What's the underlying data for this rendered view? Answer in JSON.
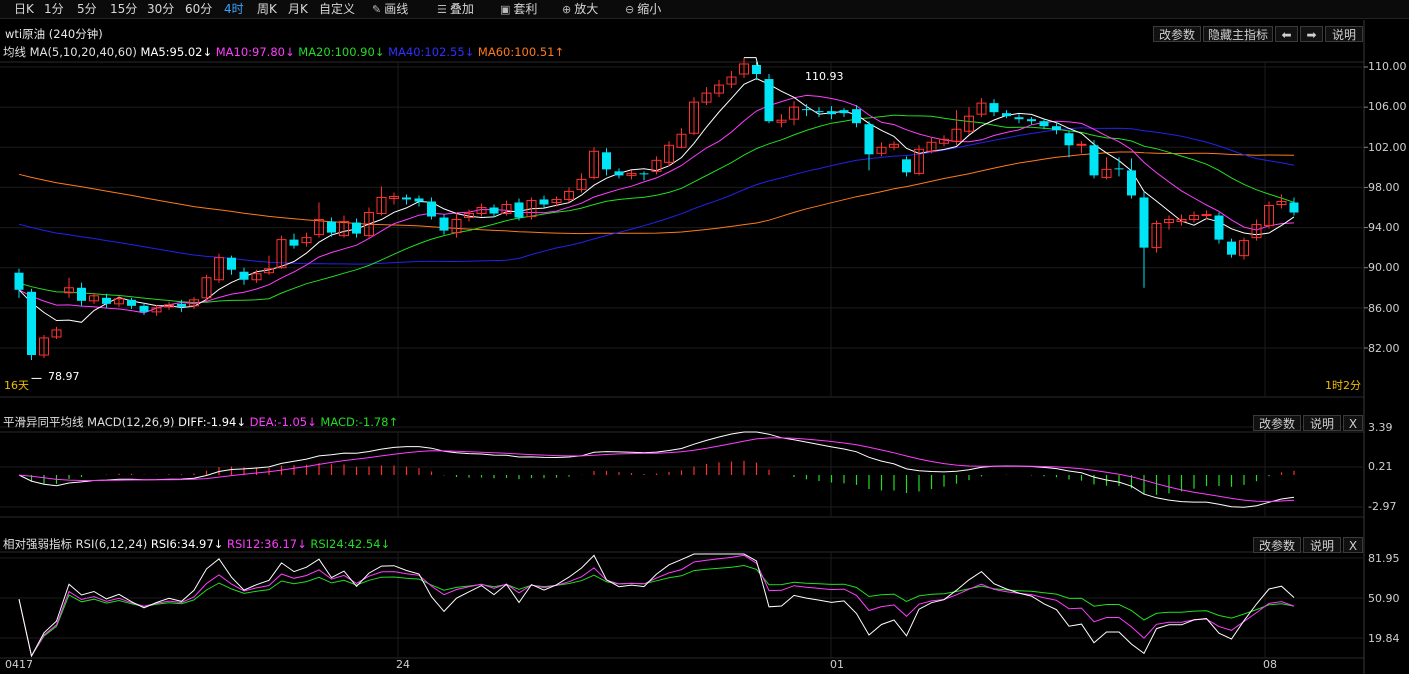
{
  "toolbar": {
    "periods": [
      "日K",
      "1分",
      "5分",
      "15分",
      "30分",
      "60分",
      "4时",
      "周K",
      "月K",
      "自定义"
    ],
    "active_period": "4时",
    "tools": [
      {
        "icon": "pencil-icon",
        "label": "画线"
      },
      {
        "icon": "layers-icon",
        "label": "叠加"
      },
      {
        "icon": "arbitrage-icon",
        "label": "套利"
      },
      {
        "icon": "zoom-in-icon",
        "label": "放大"
      },
      {
        "icon": "zoom-out-icon",
        "label": "缩小"
      }
    ]
  },
  "chart_title": "wti原油 (240分钟)",
  "main_buttons": {
    "params": "改参数",
    "hide": "隐藏主指标",
    "prev": "⬅",
    "next": "➡",
    "help": "说明"
  },
  "ma_legend": {
    "name": "均线 MA(5,10,20,40,60)",
    "ma5": "MA5:95.02↓",
    "ma10": "MA10:97.80↓",
    "ma20": "MA20:100.90↓",
    "ma40": "MA40:102.55↓",
    "ma60": "MA60:100.51↑"
  },
  "colors": {
    "ma5": "#ffffff",
    "ma10": "#ff3dff",
    "ma20": "#22dd22",
    "ma40": "#2222ee",
    "ma60": "#ff7a1a",
    "up": "#ff3030",
    "down": "#00e5f5"
  },
  "price_axis": [
    "110.00",
    "106.00",
    "102.00",
    "98.00",
    "94.00",
    "90.00",
    "86.00",
    "82.00"
  ],
  "annotations": {
    "high": "110.93",
    "low": "78.97",
    "left_span": "16天",
    "right_span": "1时2分"
  },
  "macd": {
    "legend_name": "平滑异同平均线 MACD(12,26,9)",
    "diff": "DIFF:-1.94↓",
    "dea": "DEA:-1.05↓",
    "macd": "MACD:-1.78↑",
    "axis": [
      "3.39",
      "0.21",
      "-2.97"
    ],
    "buttons": {
      "params": "改参数",
      "help": "说明",
      "close": "X"
    }
  },
  "rsi": {
    "legend_name": "相对强弱指标 RSI(6,12,24)",
    "rsi6": "RSI6:34.97↓",
    "rsi12": "RSI12:36.17↓",
    "rsi24": "RSI24:42.54↓",
    "axis": [
      "81.95",
      "50.90",
      "19.84"
    ],
    "buttons": {
      "params": "改参数",
      "help": "说明",
      "close": "X"
    }
  },
  "x_axis": [
    "0417",
    "24",
    "01",
    "08"
  ],
  "chart_data": {
    "type": "candlestick",
    "title": "wti原油 (240分钟)",
    "y_ticks": [
      110,
      106,
      102,
      98,
      94,
      90,
      86,
      82
    ],
    "high": 110.93,
    "low": 78.97,
    "candles": [
      [
        89.5,
        87.8,
        89.9,
        87.0
      ],
      [
        87.6,
        81.3,
        87.9,
        80.8
      ],
      [
        81.3,
        83.0,
        83.3,
        81.0
      ],
      [
        83.1,
        83.8,
        84.1,
        82.9
      ],
      [
        87.5,
        88.0,
        89.0,
        87.0
      ],
      [
        88.0,
        86.7,
        88.5,
        86.2
      ],
      [
        86.7,
        87.2,
        87.5,
        86.4
      ],
      [
        87.0,
        86.4,
        87.4,
        86.0
      ],
      [
        86.4,
        86.9,
        87.2,
        86.1
      ],
      [
        86.8,
        86.2,
        87.0,
        85.9
      ],
      [
        86.2,
        85.6,
        86.5,
        85.3
      ],
      [
        85.6,
        86.0,
        86.3,
        85.2
      ],
      [
        86.1,
        86.3,
        86.6,
        85.8
      ],
      [
        86.4,
        86.1,
        86.8,
        85.6
      ],
      [
        86.2,
        86.8,
        87.1,
        85.9
      ],
      [
        87.0,
        89.0,
        89.3,
        86.7
      ],
      [
        88.8,
        91.0,
        91.4,
        88.5
      ],
      [
        91.0,
        89.8,
        91.2,
        89.3
      ],
      [
        89.6,
        88.8,
        90.0,
        88.3
      ],
      [
        88.8,
        89.4,
        89.8,
        88.5
      ],
      [
        89.5,
        89.9,
        91.2,
        89.3
      ],
      [
        90.0,
        92.8,
        93.2,
        89.9
      ],
      [
        92.8,
        92.2,
        93.4,
        91.9
      ],
      [
        92.5,
        93.0,
        93.5,
        92.1
      ],
      [
        93.3,
        94.8,
        96.5,
        93.0
      ],
      [
        94.6,
        93.5,
        95.0,
        93.1
      ],
      [
        93.2,
        94.6,
        95.2,
        93.0
      ],
      [
        94.5,
        93.4,
        94.9,
        93.0
      ],
      [
        93.2,
        95.5,
        96.0,
        93.0
      ],
      [
        95.4,
        97.0,
        98.1,
        95.2
      ],
      [
        96.9,
        97.1,
        97.5,
        96.3
      ],
      [
        97.0,
        96.8,
        97.3,
        96.3
      ],
      [
        96.9,
        96.6,
        97.2,
        96.1
      ],
      [
        96.6,
        95.1,
        97.0,
        94.8
      ],
      [
        95.0,
        93.7,
        95.3,
        93.3
      ],
      [
        93.5,
        94.8,
        95.5,
        93.0
      ],
      [
        95.0,
        95.4,
        95.8,
        94.6
      ],
      [
        95.4,
        96.0,
        96.4,
        95.1
      ],
      [
        96.0,
        95.4,
        96.3,
        95.0
      ],
      [
        95.4,
        96.3,
        96.7,
        95.2
      ],
      [
        96.5,
        95.0,
        96.9,
        94.7
      ],
      [
        95.1,
        96.7,
        97.0,
        94.8
      ],
      [
        96.8,
        96.3,
        97.2,
        96.0
      ],
      [
        96.5,
        96.8,
        97.1,
        96.1
      ],
      [
        96.8,
        97.6,
        98.0,
        96.5
      ],
      [
        97.8,
        98.8,
        99.4,
        97.5
      ],
      [
        99.0,
        101.6,
        102.0,
        98.8
      ],
      [
        101.5,
        99.8,
        101.9,
        99.2
      ],
      [
        99.6,
        99.2,
        99.9,
        98.9
      ],
      [
        99.2,
        99.4,
        99.7,
        98.8
      ],
      [
        99.4,
        99.3,
        99.6,
        98.7
      ],
      [
        99.6,
        100.7,
        101.1,
        99.3
      ],
      [
        100.5,
        102.2,
        102.6,
        100.1
      ],
      [
        102.0,
        103.3,
        103.9,
        101.9
      ],
      [
        103.4,
        106.5,
        107.0,
        103.2
      ],
      [
        106.5,
        107.4,
        108.0,
        106.2
      ],
      [
        107.4,
        108.2,
        108.7,
        107.0
      ],
      [
        108.3,
        109.0,
        109.6,
        107.9
      ],
      [
        109.3,
        110.3,
        110.93,
        108.9
      ],
      [
        110.2,
        109.3,
        110.5,
        108.7
      ],
      [
        108.8,
        104.6,
        109.3,
        104.4
      ],
      [
        104.5,
        104.7,
        105.3,
        104.0
      ],
      [
        104.8,
        106.0,
        106.6,
        104.2
      ],
      [
        105.8,
        105.7,
        106.3,
        105.1
      ],
      [
        105.6,
        105.5,
        106.0,
        105.0
      ],
      [
        105.6,
        105.3,
        106.1,
        104.8
      ],
      [
        105.7,
        105.4,
        105.9,
        105.0
      ],
      [
        105.8,
        104.4,
        106.2,
        104.0
      ],
      [
        104.3,
        101.3,
        104.6,
        99.7
      ],
      [
        101.4,
        102.0,
        102.5,
        101.1
      ],
      [
        102.0,
        102.3,
        102.6,
        101.7
      ],
      [
        100.8,
        99.5,
        101.1,
        99.1
      ],
      [
        99.4,
        101.8,
        102.2,
        99.2
      ],
      [
        101.6,
        102.5,
        103.0,
        101.4
      ],
      [
        102.4,
        102.8,
        103.2,
        102.1
      ],
      [
        102.6,
        103.8,
        105.7,
        102.2
      ],
      [
        103.6,
        105.1,
        106.0,
        103.3
      ],
      [
        105.3,
        106.4,
        106.9,
        105.0
      ],
      [
        106.4,
        105.5,
        106.8,
        105.1
      ],
      [
        105.4,
        105.1,
        105.7,
        104.9
      ],
      [
        105.0,
        104.8,
        105.3,
        104.4
      ],
      [
        104.8,
        104.6,
        105.0,
        104.3
      ],
      [
        104.6,
        104.1,
        104.8,
        103.8
      ],
      [
        104.1,
        103.7,
        104.5,
        103.3
      ],
      [
        103.4,
        102.2,
        103.6,
        101.0
      ],
      [
        102.3,
        102.3,
        102.6,
        101.4
      ],
      [
        102.2,
        99.2,
        102.7,
        98.9
      ],
      [
        99.0,
        99.8,
        101.0,
        98.8
      ],
      [
        99.9,
        99.8,
        101.0,
        99.1
      ],
      [
        99.7,
        97.2,
        100.9,
        96.9
      ],
      [
        97.0,
        92.0,
        97.6,
        88.0
      ],
      [
        92.0,
        94.4,
        94.7,
        91.5
      ],
      [
        94.5,
        94.8,
        95.2,
        93.8
      ],
      [
        94.6,
        94.8,
        95.3,
        94.2
      ],
      [
        94.8,
        95.2,
        95.6,
        94.5
      ],
      [
        95.2,
        95.3,
        95.7,
        94.8
      ],
      [
        95.2,
        92.8,
        95.5,
        92.4
      ],
      [
        92.6,
        91.3,
        92.9,
        91.0
      ],
      [
        91.2,
        92.7,
        93.0,
        90.8
      ],
      [
        93.0,
        94.3,
        94.8,
        92.7
      ],
      [
        94.2,
        96.2,
        96.6,
        93.9
      ],
      [
        96.3,
        96.6,
        97.3,
        95.9
      ],
      [
        96.5,
        95.5,
        97.0,
        95.2
      ]
    ]
  }
}
